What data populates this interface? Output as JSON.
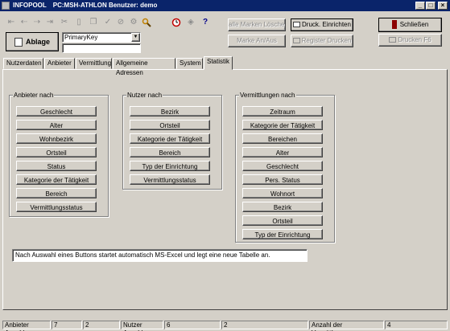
{
  "window": {
    "app_name": "INFOPOOL",
    "title_rest": "PC:MSH-ATHLON Benutzer: demo",
    "minimize": "_",
    "maximize": "□",
    "close": "×"
  },
  "toolbar": {
    "icons": [
      "first-icon",
      "prev-icon",
      "next-icon",
      "last-icon",
      "cut-icon",
      "delete-icon",
      "copy-icon",
      "check-icon",
      "cancel-icon",
      "settings-icon",
      "search-icon",
      "clock-icon",
      "tag-icon",
      "help-icon"
    ],
    "help_glyph": "?",
    "ablage_label": "Ablage",
    "key_select_value": "PrimaryKey",
    "key_input_value": "",
    "alle_marken_loeschen": "alle Marken Löschen",
    "druck_einrichten": "Druck. Einrichten",
    "schliessen": "Schließen",
    "marke_an_aus": "Marke An/Aus",
    "register_drucken": "Register Drucken",
    "drucken_f6": "Drucken F6"
  },
  "tabs": [
    "Nutzerdaten",
    "Anbieter",
    "Vermittlung",
    "Allgemeine Adressen",
    "System",
    "Statistik"
  ],
  "active_tab": "Statistik",
  "groups": {
    "anbieter": {
      "title": "Anbieter nach",
      "buttons": [
        "Geschlecht",
        "Alter",
        "Wohnbezirk",
        "Ortsteil",
        "Status",
        "Kategorie der Tätigkeit",
        "Bereich",
        "Vermittlungsstatus"
      ]
    },
    "nutzer": {
      "title": "Nutzer nach",
      "buttons": [
        "Bezirk",
        "Ortsteil",
        "Kategorie der Tätigkeit",
        "Bereich",
        "Typ der Einrichtung",
        "Vermittlungsstatus"
      ]
    },
    "vermittlungen": {
      "title": "Vermittlungen nach",
      "buttons": [
        "Zeitraum",
        "Kategorie der Tätigkeit",
        "Bereichen",
        "Alter",
        "Geschlecht",
        "Pers. Status",
        "Wohnort",
        "Bezirk",
        "Ortsteil",
        "Typ der Einrichtung"
      ]
    }
  },
  "info_text": "Nach Auswahl eines Buttons startet automatisch MS-Excel und legt eine neue Tabelle an.",
  "statusbar": {
    "anbieter_label": "Anbieter Anzahl:",
    "anbieter_value": "7",
    "cell2": "2",
    "nutzer_label": "Nutzer Anzahl:",
    "nutzer_value": "6",
    "cell4": "2",
    "vermittlungen_label": "Anzahl der Vermittlungen:",
    "vermittlungen_value": "4"
  }
}
